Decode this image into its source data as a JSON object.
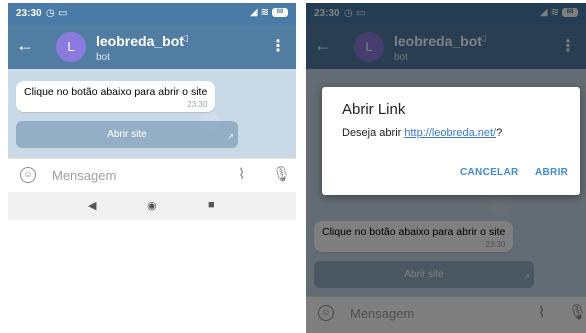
{
  "status": {
    "time": "23:30",
    "battery": "88"
  },
  "header": {
    "back_icon": "arrow-left-icon",
    "avatar_letter": "L",
    "name": "leobreda_bot",
    "subtitle": "bot"
  },
  "message": {
    "text": "Clique no botão abaixo para abrir o site",
    "time": "23:30"
  },
  "inline_button": {
    "label": "Abrir site"
  },
  "input": {
    "placeholder": "Mensagem"
  },
  "dialog": {
    "title": "Abrir Link",
    "body_prefix": "Deseja abrir ",
    "link": "http://leobreda.net/",
    "body_suffix": "?",
    "cancel_label": "CANCELAR",
    "open_label": "ABRIR"
  },
  "colors": {
    "header": "#527da3",
    "statusbar": "#4a7ba6",
    "avatar": "#8c7bde",
    "chat_bg": "#c9d9e6",
    "accent": "#3f8ccf"
  }
}
